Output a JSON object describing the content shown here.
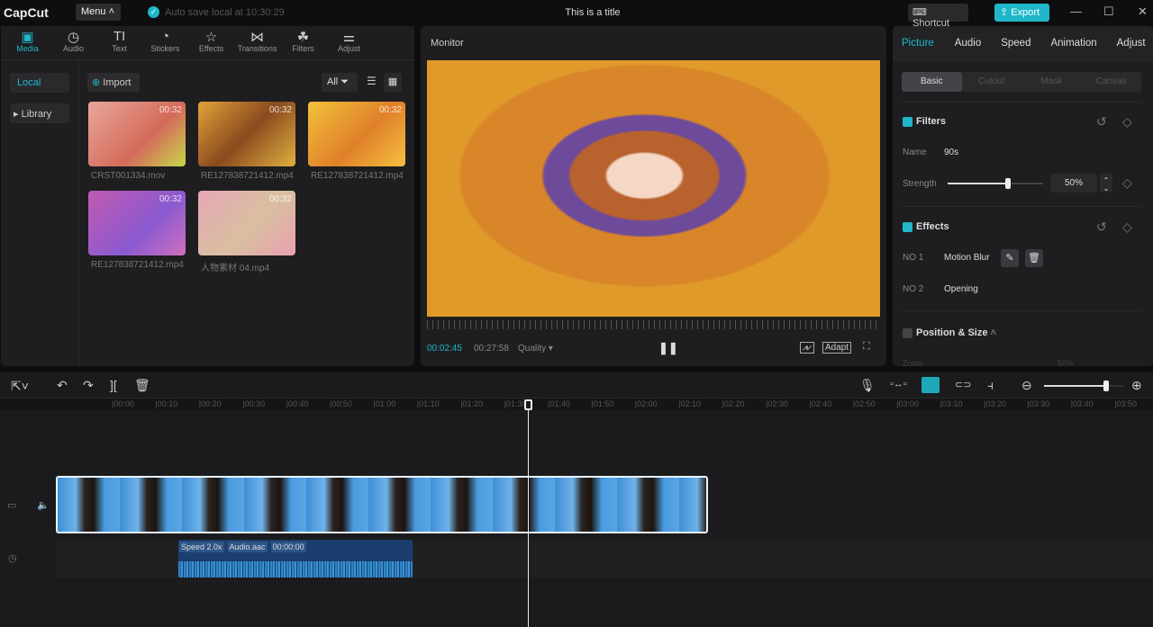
{
  "app": {
    "logo": "CapCut",
    "menu": "Menu",
    "autosave": "Auto save local at 10:30:29",
    "title": "This is a title",
    "shortcut": "Shortcut",
    "export": "Export"
  },
  "tools": [
    {
      "label": "Media",
      "icon": "▣"
    },
    {
      "label": "Audio",
      "icon": "◷"
    },
    {
      "label": "Text",
      "icon": "TI"
    },
    {
      "label": "Stickers",
      "icon": "◔"
    },
    {
      "label": "Effects",
      "icon": "☆"
    },
    {
      "label": "Transitions",
      "icon": "⋈"
    },
    {
      "label": "Filters",
      "icon": "☘"
    },
    {
      "label": "Adjust",
      "icon": "⚌"
    }
  ],
  "media": {
    "local": "Local",
    "library": "▸ Library",
    "import": "Import",
    "filter_all": "All",
    "items": [
      {
        "name": "CRST001334.mov",
        "duration": "00:32"
      },
      {
        "name": "RE127838721412.mp4",
        "duration": "00:32"
      },
      {
        "name": "RE127838721412.mp4",
        "duration": "00:32"
      },
      {
        "name": "RE127838721412.mp4",
        "duration": "00:32"
      },
      {
        "name": "人物素材 04.mp4",
        "duration": "00:32"
      }
    ]
  },
  "monitor": {
    "title": "Monitor",
    "current": "00:02:45",
    "total": "00:27:58",
    "quality": "Quality ▾",
    "adapt": "Adapt"
  },
  "props": {
    "tabs": [
      "Picture",
      "Audio",
      "Speed",
      "Animation",
      "Adjust"
    ],
    "subtabs": [
      "Basic",
      "Cutout",
      "Mask",
      "Canvas"
    ],
    "filters": {
      "title": "Filters",
      "name_label": "Name",
      "name": "90s",
      "strength_label": "Strength",
      "strength": "50%",
      "strength_value": 0.5
    },
    "effects": {
      "title": "Effects",
      "items": [
        {
          "no": "NO 1",
          "name": "Motion Blur"
        },
        {
          "no": "NO 2",
          "name": "Opening"
        }
      ]
    },
    "position": {
      "title": "Position & Size",
      "zoom_label": "Zoom",
      "zoom": "50%"
    }
  },
  "timeline": {
    "ruler": [
      "00:00",
      "00:10",
      "00:20",
      "00:30",
      "00:40",
      "00:50",
      "01:00",
      "01:10",
      "01:20",
      "01:30",
      "01:40",
      "01:50",
      "02:00",
      "02:10",
      "02:20",
      "02:30",
      "02:40",
      "02:50",
      "03:00",
      "03:10",
      "03:20",
      "03:30",
      "03:40",
      "03:50"
    ],
    "audio": {
      "speed": "Speed 2.0x",
      "name": "Audio.aac",
      "time": "00:00:00"
    },
    "zoom_level": 0.75
  },
  "colors": {
    "accent": "#1fb7c9"
  }
}
